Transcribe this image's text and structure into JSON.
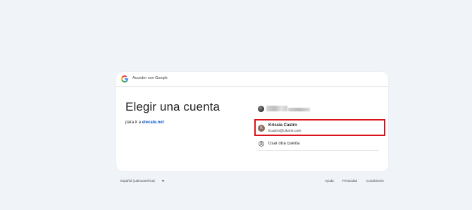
{
  "header": {
    "title": "Acceder con Google"
  },
  "main": {
    "title": "Elegir una cuenta",
    "subtitle_prefix": "para ir a",
    "subtitle_link": "elecate.net"
  },
  "accounts": [
    {
      "avatar_icon": "user-photo",
      "name": "",
      "email": "",
      "blurred": true
    },
    {
      "avatar_letter": "K",
      "avatar_color": "#8d6e63",
      "name": "Krissia Castro",
      "email": "kcastro@cilume.com",
      "highlighted": true,
      "highlight_color": "#d9121b"
    }
  ],
  "other_account": {
    "icon": "person-circle-icon",
    "label": "Usar otra cuenta"
  },
  "footer": {
    "language": "Español (Latinoamérica)",
    "language_icon": "chevron-down-icon",
    "links": {
      "help": "Ayuda",
      "privacy": "Privacidad",
      "terms": "Condiciones"
    }
  },
  "colors": {
    "page_background": "#f0f4f9",
    "card_background": "#ffffff",
    "link": "#0b57d0"
  }
}
